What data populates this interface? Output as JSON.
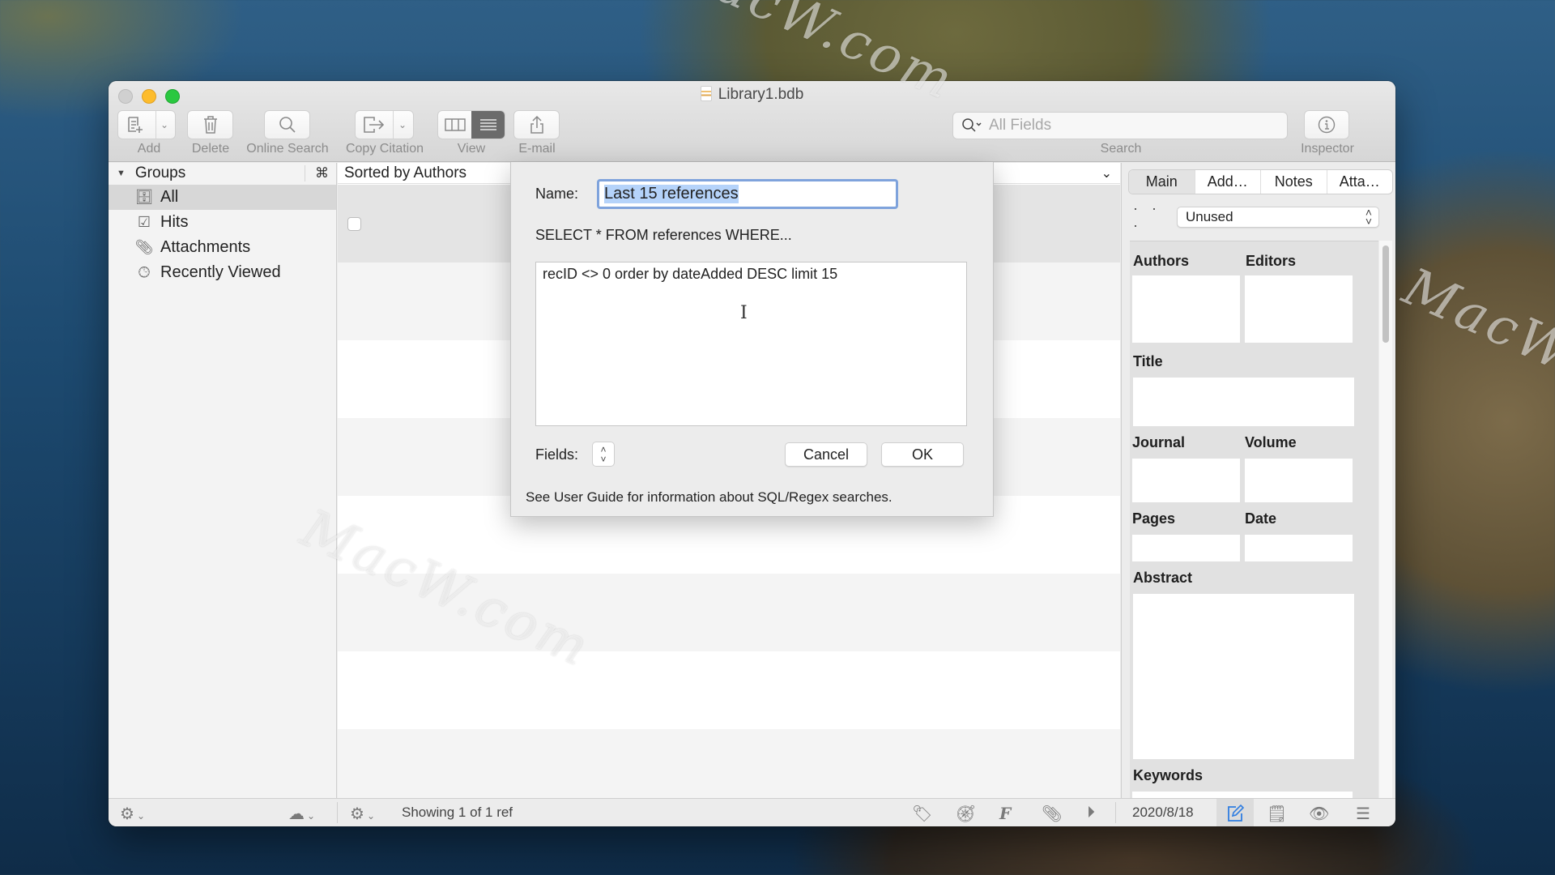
{
  "window": {
    "title": "Library1.bdb"
  },
  "toolbar": {
    "add_label": "Add",
    "delete_label": "Delete",
    "online_search_label": "Online Search",
    "copy_citation_label": "Copy Citation",
    "view_label": "View",
    "email_label": "E-mail",
    "search_label": "Search",
    "search_placeholder": "All Fields",
    "inspector_label": "Inspector"
  },
  "sidebar": {
    "header": "Groups",
    "header_shortcut": "⌘",
    "items": [
      {
        "label": "All",
        "icon": "library-icon",
        "selected": true
      },
      {
        "label": "Hits",
        "icon": "checkbox-icon",
        "selected": false
      },
      {
        "label": "Attachments",
        "icon": "paperclip-icon",
        "selected": false
      },
      {
        "label": "Recently Viewed",
        "icon": "clock-icon",
        "selected": false
      }
    ]
  },
  "list": {
    "sort_header": "Sorted by Authors",
    "rows": [
      {
        "checked": false
      }
    ]
  },
  "dialog": {
    "name_label": "Name:",
    "name_value": "Last 15 references",
    "query_prefix": "SELECT * FROM references WHERE...",
    "query_text": "recID <> 0 order by dateAdded DESC limit 15",
    "fields_label": "Fields:",
    "cancel_label": "Cancel",
    "ok_label": "OK",
    "help_text": "See User Guide for information about SQL/Regex searches."
  },
  "inspector": {
    "tabs": [
      {
        "label": "Main",
        "active": true
      },
      {
        "label": "Add…",
        "active": false
      },
      {
        "label": "Notes",
        "active": false
      },
      {
        "label": "Atta…",
        "active": false
      }
    ],
    "dots": "· · ·",
    "pub_type": "Unused",
    "fields": {
      "authors": "Authors",
      "editors": "Editors",
      "title": "Title",
      "journal": "Journal",
      "volume": "Volume",
      "pages": "Pages",
      "date": "Date",
      "abstract": "Abstract",
      "keywords": "Keywords"
    }
  },
  "statusbar": {
    "status_text": "Showing 1 of 1 ref",
    "date_added": "2020/8/18"
  },
  "colors": {
    "accent": "#2f7de1",
    "selection_highlight": "#b5d3fa",
    "focus_ring": "#7fa3dc"
  },
  "watermarks": [
    "MacW.com",
    "MacW.com",
    "MacW.c"
  ]
}
